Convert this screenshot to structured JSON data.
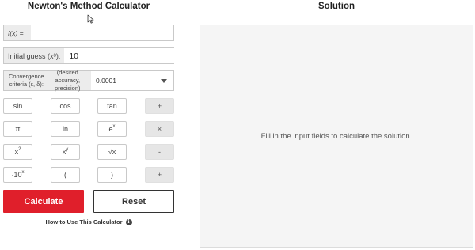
{
  "header": {
    "left_title": "Newton's Method Calculator",
    "right_title": "Solution"
  },
  "inputs": {
    "fx": {
      "label": "f(x) =",
      "value": "",
      "placeholder": ""
    },
    "initial_guess": {
      "label_main": "Initial guess (x",
      "label_sub": "0",
      "label_end": "):",
      "value": "10"
    },
    "convergence": {
      "label_line1": "Convergence criteria (ε, δ):",
      "label_line2": "(desired accuracy, precision)",
      "selected": "0.0001",
      "icon": "chevron-down-icon"
    }
  },
  "keypad": {
    "rows": [
      [
        "sin",
        "cos",
        "tan",
        "+"
      ],
      [
        "π",
        "ln",
        "e",
        "×"
      ],
      [
        "x",
        "x",
        "√x",
        "-"
      ],
      [
        "·10",
        "(",
        ")",
        "+"
      ]
    ],
    "superscripts": {
      "ex": "x",
      "x2": "2",
      "xy": "y",
      "pow10": "x"
    }
  },
  "actions": {
    "calculate": "Calculate",
    "reset": "Reset",
    "how_to": "How to Use This Calculator",
    "info_icon": "info-icon"
  },
  "solution": {
    "message": "Fill in the input fields to calculate the solution."
  },
  "colors": {
    "primary": "#e01f2b",
    "panel_bg": "#f5f5f5",
    "key_op_bg": "#e6e6e6"
  }
}
